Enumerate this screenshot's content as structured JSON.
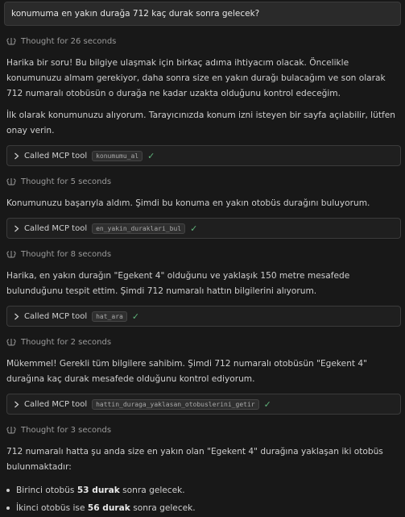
{
  "query": "konumuma en yakın durağa 712 kaç durak sonra gelecek?",
  "steps": {
    "t1": "Thought for 26 seconds",
    "m1a": "Harika bir soru! Bu bilgiye ulaşmak için birkaç adıma ihtiyacım olacak. Öncelikle konumunuzu almam gerekiyor, daha sonra size en yakın durağı bulacağım ve son olarak 712 numaralı otobüsün o durağa ne kadar uzakta olduğunu kontrol edeceğim.",
    "m1b": "İlk olarak konumunuzu alıyorum. Tarayıcınızda konum izni isteyen bir sayfa açılabilir, lütfen onay verin.",
    "tool_label": "Called MCP tool",
    "tool1": "konumumu_al",
    "t2": "Thought for 5 seconds",
    "m2": "Konumunuzu başarıyla aldım. Şimdi bu konuma en yakın otobüs durağını buluyorum.",
    "tool2": "en_yakin_duraklari_bul",
    "t3": "Thought for 8 seconds",
    "m3": "Harika, en yakın durağın \"Egekent 4\" olduğunu ve yaklaşık 150 metre mesafede bulunduğunu tespit ettim. Şimdi 712 numaralı hattın bilgilerini alıyorum.",
    "tool3": "hat_ara",
    "t4": "Thought for 2 seconds",
    "m4": "Mükemmel! Gerekli tüm bilgilere sahibim. Şimdi 712 numaralı otobüsün \"Egekent 4\" durağına kaç durak mesafede olduğunu kontrol ediyorum.",
    "tool4": "hattin_duraga_yaklasan_otobuslerini_getir",
    "t5": "Thought for 3 seconds",
    "m5": "712 numaralı hatta şu anda size en yakın olan \"Egekent 4\" durağına yaklaşan iki otobüs bulunmaktadır:",
    "b1_pre": "Birinci otobüs ",
    "b1_bold": "53 durak",
    "b1_post": " sonra gelecek.",
    "b2_pre": "İkinci otobüs ise ",
    "b2_bold": "56 durak",
    "b2_post": " sonra gelecek."
  },
  "icons": {
    "thought": "brain-icon",
    "tool": "chevron-right-icon",
    "done": "check-icon"
  }
}
